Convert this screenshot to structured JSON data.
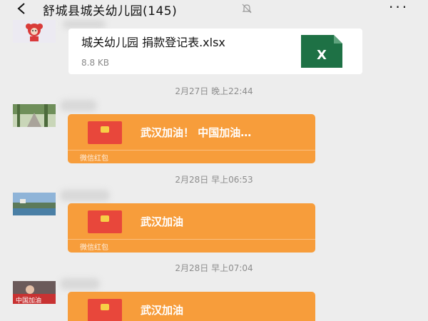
{
  "header": {
    "title": "舒城县城关幼儿园(145)",
    "back_icon": "chevron-left-icon",
    "mute_icon": "bell-off-icon",
    "more_label": "···"
  },
  "messages": {
    "file": {
      "file_name": "城关幼儿园 捐款登记表.xlsx",
      "file_size": "8.8 KB",
      "file_icon": "excel-icon",
      "icon_color": "#1e7145",
      "icon_letter": "X"
    },
    "timestamps": [
      "2月27日 晚上22:44",
      "2月28日 早上06:53",
      "2月28日 早上07:04"
    ],
    "red_packets": [
      {
        "message": "武汉加油！ 中国加油…",
        "label": "微信红包"
      },
      {
        "message": "武汉加油",
        "label": "微信红包"
      },
      {
        "message": "武汉加油",
        "label": ""
      }
    ],
    "avatar_caption": "中国加油"
  },
  "colors": {
    "background": "#ededed",
    "red_packet": "#f79d3b",
    "envelope": "#e8473b",
    "bubble": "#ffffff"
  }
}
